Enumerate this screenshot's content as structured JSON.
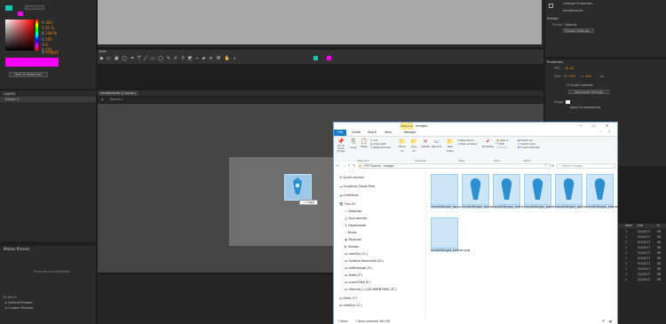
{
  "app": {
    "color_panel": {
      "values_h": [
        "300",
        "51 %",
        "100 %"
      ],
      "values_rgb": [
        "255",
        "0",
        "255"
      ],
      "hex": "FF00FF",
      "hex_label": "#",
      "add_swatches": "Add To Swatches",
      "labels_h": [
        "H",
        "S",
        "B"
      ],
      "labels_rgb": [
        "R",
        "G",
        "B"
      ]
    },
    "layers_panel": {
      "title": "Layers",
      "item": "Scene 1"
    },
    "motion_presets": {
      "title": "Motion Presets",
      "preview": "Preview not available",
      "count": "39 items",
      "folders": [
        "Default Presets",
        "Custom Presets"
      ]
    },
    "tools": {
      "title": "Tools"
    },
    "stage_tab": {
      "label": "healthbar.fla [Canvas]",
      "scene": "Scene 1"
    },
    "drag_ghost": {
      "label": "Copy"
    },
    "right_panel": {
      "top_items": [
        "Linkage Properties",
        "healthbar.fla"
      ],
      "publish_title": "Publish",
      "profile_label": "Profile",
      "profile_value": "Default",
      "publish_settings": "Publish Settings...",
      "properties_title": "Properties",
      "fps_label": "FPS",
      "fps_value": "24.00",
      "size_label": "Size",
      "size_w_label": "W",
      "size_w": "550",
      "size_h_label": "H",
      "size_h": "400",
      "size_unit": "px",
      "scale_content": "Scale Content",
      "advanced_settings": "Advanced Settings",
      "stage_label": "Stage",
      "apply_parent": "Apply to pasteboard",
      "timeline_cols": [
        "Start",
        "End",
        "Fr"
      ],
      "timeline_rows": [
        [
          "1",
          "5/3/2017",
          "98"
        ],
        [
          "1",
          "5/3/2017",
          "98"
        ],
        [
          "1",
          "5/3/2017",
          "98"
        ],
        [
          "1",
          "5/3/2017",
          "98"
        ],
        [
          "1",
          "5/3/2017",
          "98"
        ],
        [
          "1",
          "5/3/2017",
          "98"
        ],
        [
          "1",
          "5/3/2017",
          "98"
        ],
        [
          "1",
          "5/3/2017",
          "98"
        ],
        [
          "1",
          "5/3/2017",
          "98"
        ],
        [
          "1",
          "5/3/2017",
          "98"
        ]
      ]
    }
  },
  "explorer": {
    "title": "images",
    "contextual_tab": "Picture Tools",
    "tabs": [
      "File",
      "Home",
      "Share",
      "View",
      "Manage"
    ],
    "ribbon": {
      "pin": "Pin to Quick access",
      "copy": "Copy",
      "paste": "Paste",
      "cut": "Cut",
      "copy_path": "Copy path",
      "paste_shortcut": "Paste shortcut",
      "move_to": "Move to",
      "copy_to": "Copy to",
      "delete": "Delete",
      "rename": "Rename",
      "new_folder": "New folder",
      "new_item": "New item",
      "easy_access": "Easy access",
      "properties": "Properties",
      "open": "Open",
      "edit": "Edit",
      "history": "History",
      "select_all": "Select all",
      "select_none": "Select none",
      "invert": "Invert selection",
      "groups": [
        "Clipboard",
        "Organize",
        "New",
        "Open",
        "Select"
      ]
    },
    "breadcrumb": [
      "FPS Tutorial",
      "images"
    ],
    "search_placeholder": "Search images",
    "nav": [
      "Quick access",
      "Creative Cloud Files",
      "OneDrive",
      "This PC",
      "Desktop",
      "Documents",
      "Downloads",
      "Music",
      "Pictures",
      "Videos",
      "newSys (C:)",
      "System Reserved (D:)",
      "oldStorage (E:)",
      "Data (F:)",
      "Local Disk (F:)",
      "Volume_1 (\\\\ZCMIRNTKM) (Z:)",
      "Data (F:)",
      "newSys (C:)"
    ],
    "files": [
      "HealthWidget_bg.png",
      "HealthWidget_bottbody_Blue.png",
      "HealthWidget_bottHand_Blue.png",
      "HealthWidget_bottHand_Blue_L.png",
      "HealthWidget_bottleg_Blue.png",
      "HealthWidget_bottleg_Blue_L.png",
      "HealthWidget_skillbar.png"
    ],
    "status": {
      "count": "7 items",
      "selected": "7 items selected 360 KB"
    }
  }
}
